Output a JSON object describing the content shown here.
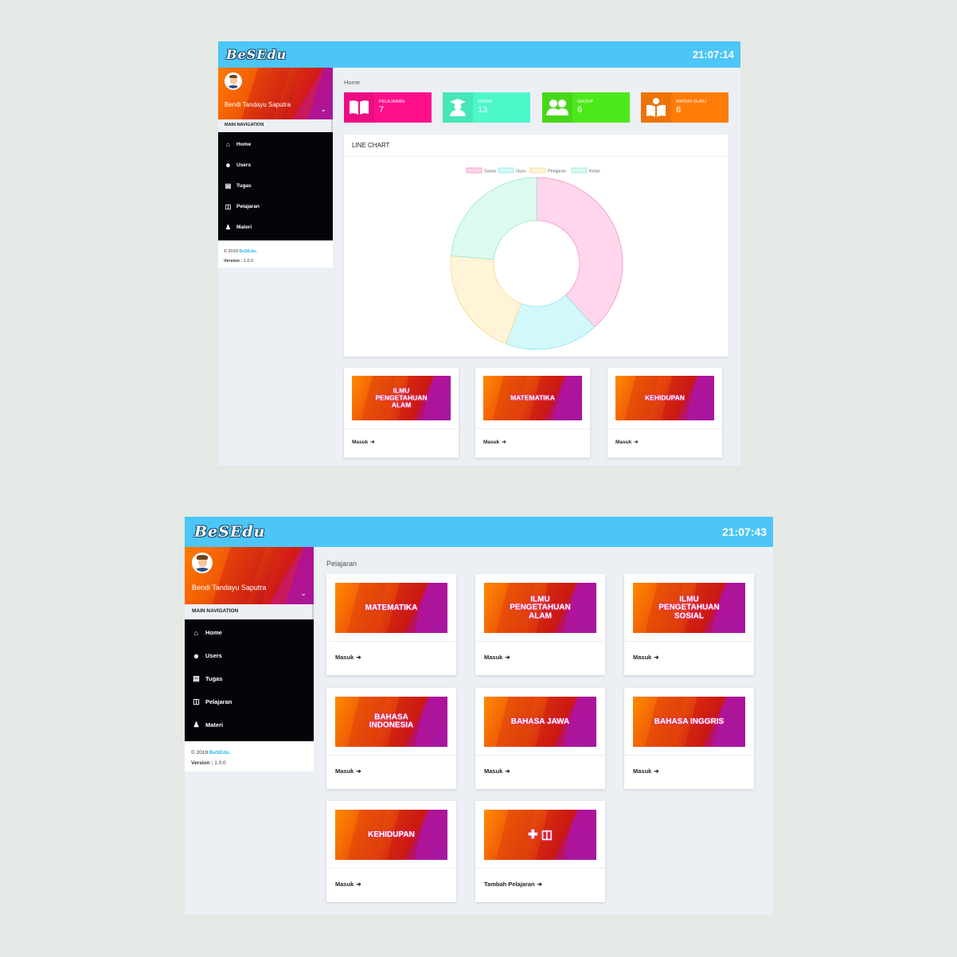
{
  "screen1": {
    "logo": "BeSEdu",
    "clock": "21:07:14",
    "user_name": "Bendi Tandayu Saputra",
    "nav_header": "MAIN NAVIGATION",
    "nav": [
      {
        "label": "Home",
        "icon": "home-icon",
        "glyph": "⌂"
      },
      {
        "label": "Users",
        "icon": "users-icon",
        "glyph": "☻"
      },
      {
        "label": "Tugas",
        "icon": "file-icon",
        "glyph": "▤"
      },
      {
        "label": "Pelajaran",
        "icon": "book-icon",
        "glyph": "◫"
      },
      {
        "label": "Materi",
        "icon": "teacher-icon",
        "glyph": "♟"
      }
    ],
    "footer": {
      "copyright": "© 2019 ",
      "brand": "BeSEdu.",
      "version_label": "Version :",
      "version": " 1.0.0"
    },
    "breadcrumb": "Home",
    "stats": [
      {
        "label": "PELAJARAN",
        "value": "7",
        "color": "#ff0f8c",
        "icon": "book-icon"
      },
      {
        "label": "SISWA",
        "value": "13",
        "color": "#4cf8c8",
        "icon": "graduate-icon"
      },
      {
        "label": "GROUP",
        "value": "6",
        "color": "#4de81a",
        "icon": "group-icon"
      },
      {
        "label": "MATERI GURU",
        "value": "6",
        "color": "#ff7c09",
        "icon": "reader-icon"
      }
    ],
    "chart_title": "LINE CHART",
    "courses": [
      {
        "title": "ILMU PENGETAHUAN ALAM",
        "link": "Masuk"
      },
      {
        "title": "MATEMATIKA",
        "link": "Masuk"
      },
      {
        "title": "KEHIDUPAN",
        "link": "Masuk"
      }
    ]
  },
  "chart_data": {
    "type": "pie",
    "variant": "doughnut",
    "title": "",
    "legend_position": "top",
    "labels": [
      "Siswa",
      "Guru",
      "Pelajaran",
      "Kelas"
    ],
    "values": [
      13,
      6,
      7,
      8
    ],
    "fill_colors": [
      "#ffd6ec",
      "#d3f8fb",
      "#fff4d7",
      "#dcfaee"
    ],
    "border_colors": [
      "#f58fc5",
      "#8fe3ee",
      "#f8d88a",
      "#9be8c8"
    ]
  },
  "screen2": {
    "logo": "BeSEdu",
    "clock": "21:07:43",
    "user_name": "Bendi Tandayu Saputra",
    "nav_header": "MAIN NAVIGATION",
    "nav": [
      {
        "label": "Home",
        "icon": "home-icon",
        "glyph": "⌂"
      },
      {
        "label": "Users",
        "icon": "users-icon",
        "glyph": "☻"
      },
      {
        "label": "Tugas",
        "icon": "file-icon",
        "glyph": "▤"
      },
      {
        "label": "Pelajaran",
        "icon": "book-icon",
        "glyph": "◫"
      },
      {
        "label": "Materi",
        "icon": "teacher-icon",
        "glyph": "♟"
      }
    ],
    "footer": {
      "copyright": "© 2019 ",
      "brand": "BeSEdu.",
      "version_label": "Version :",
      "version": " 1.0.0"
    },
    "breadcrumb": "Pelajaran",
    "courses": [
      {
        "title": "MATEMATIKA",
        "link": "Masuk"
      },
      {
        "title": "ILMU PENGETAHUAN ALAM",
        "link": "Masuk"
      },
      {
        "title": "ILMU PENGETAHUAN SOSIAL",
        "link": "Masuk"
      },
      {
        "title": "BAHASA INDONESIA",
        "link": "Masuk"
      },
      {
        "title": "BAHASA JAWA",
        "link": "Masuk"
      },
      {
        "title": "BAHASA INGGRIS",
        "link": "Masuk"
      },
      {
        "title": "KEHIDUPAN",
        "link": "Masuk"
      },
      {
        "title": "",
        "icon": "plus-book-icon",
        "link": "Tambah Pelajaran"
      }
    ]
  }
}
